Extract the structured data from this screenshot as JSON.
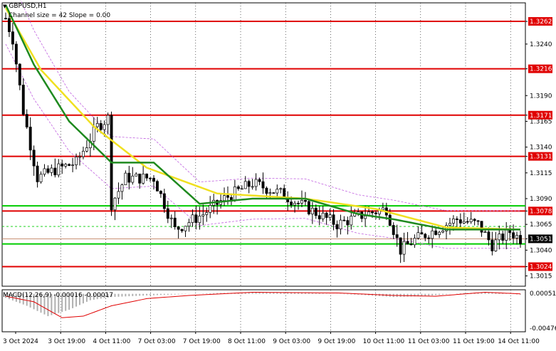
{
  "header": {
    "symbol_timeframe": "GBPUSD,H1",
    "channel_info": "Channel size = 42 Slope = 0.00"
  },
  "macd": {
    "label": "MACD(12,26,9) -0.00016 -0.00017",
    "axis_top": "0.00051",
    "axis_bottom": "-0.00476"
  },
  "colors": {
    "level_line": "#e00000",
    "support_line": "#00cc00",
    "candle": "#000000",
    "fast_ma": "#f0e020",
    "slow_ma": "#1f8a1f",
    "envelope": "#c060e0",
    "macd_hist": "#b0b0b0",
    "macd_signal": "#e00000",
    "price_label_bg": "#e00000",
    "current_price_bg": "#000000"
  },
  "chart_data": {
    "type": "candlestick",
    "symbol": "GBPUSD",
    "timeframe": "H1",
    "ylim": [
      1.3005,
      1.328
    ],
    "y_ticks": [
      "1.3262",
      "1.3240",
      "1.3216",
      "1.3190",
      "1.3171",
      "1.3165",
      "1.3140",
      "1.3131",
      "1.3115",
      "1.3090",
      "1.3078",
      "1.3065",
      "1.3051",
      "1.3040",
      "1.3024",
      "1.3015"
    ],
    "x_labels": [
      "3 Oct 2024",
      "3 Oct 19:00",
      "4 Oct 11:00",
      "7 Oct 03:00",
      "7 Oct 19:00",
      "8 Oct 11:00",
      "9 Oct 03:00",
      "9 Oct 19:00",
      "10 Oct 11:00",
      "11 Oct 03:00",
      "11 Oct 19:00",
      "14 Oct 11:00"
    ],
    "resistance_levels": [
      1.3262,
      1.3216,
      1.3171,
      1.3131,
      1.3078
    ],
    "support_levels": [
      1.3024
    ],
    "green_levels": [
      1.3083,
      1.3046
    ],
    "current_price": 1.3051,
    "key_points": [
      {
        "t": 0,
        "p": 1.3265
      },
      {
        "t": 2,
        "p": 1.3245
      },
      {
        "t": 5,
        "p": 1.3175
      },
      {
        "t": 9,
        "p": 1.311
      },
      {
        "t": 14,
        "p": 1.3118
      },
      {
        "t": 20,
        "p": 1.3125
      },
      {
        "t": 26,
        "p": 1.316
      },
      {
        "t": 29,
        "p": 1.3168
      },
      {
        "t": 30,
        "p": 1.3085
      },
      {
        "t": 34,
        "p": 1.311
      },
      {
        "t": 42,
        "p": 1.311
      },
      {
        "t": 48,
        "p": 1.306
      },
      {
        "t": 56,
        "p": 1.3075
      },
      {
        "t": 62,
        "p": 1.309
      },
      {
        "t": 70,
        "p": 1.3105
      },
      {
        "t": 78,
        "p": 1.3095
      },
      {
        "t": 86,
        "p": 1.308
      },
      {
        "t": 94,
        "p": 1.3065
      },
      {
        "t": 102,
        "p": 1.3075
      },
      {
        "t": 108,
        "p": 1.308
      },
      {
        "t": 112,
        "p": 1.304
      },
      {
        "t": 116,
        "p": 1.305
      },
      {
        "t": 122,
        "p": 1.306
      },
      {
        "t": 128,
        "p": 1.307
      },
      {
        "t": 134,
        "p": 1.3065
      },
      {
        "t": 138,
        "p": 1.3045
      },
      {
        "t": 143,
        "p": 1.3058
      },
      {
        "t": 146,
        "p": 1.3051
      }
    ],
    "fast_ma": [
      {
        "t": 0,
        "p": 1.3275
      },
      {
        "t": 10,
        "p": 1.3215
      },
      {
        "t": 25,
        "p": 1.316
      },
      {
        "t": 40,
        "p": 1.312
      },
      {
        "t": 60,
        "p": 1.3095
      },
      {
        "t": 85,
        "p": 1.309
      },
      {
        "t": 105,
        "p": 1.308
      },
      {
        "t": 125,
        "p": 1.3062
      },
      {
        "t": 146,
        "p": 1.306
      }
    ],
    "slow_ma": [
      {
        "t": 0,
        "p": 1.3278
      },
      {
        "t": 8,
        "p": 1.322
      },
      {
        "t": 18,
        "p": 1.3165
      },
      {
        "t": 30,
        "p": 1.3125
      },
      {
        "t": 42,
        "p": 1.3125
      },
      {
        "t": 55,
        "p": 1.3085
      },
      {
        "t": 70,
        "p": 1.309
      },
      {
        "t": 85,
        "p": 1.309
      },
      {
        "t": 100,
        "p": 1.3075
      },
      {
        "t": 110,
        "p": 1.307
      },
      {
        "t": 125,
        "p": 1.306
      },
      {
        "t": 135,
        "p": 1.306
      },
      {
        "t": 146,
        "p": 1.306
      }
    ],
    "macd_hist": [
      {
        "t": 0,
        "v": -0.0005
      },
      {
        "t": 6,
        "v": -0.0015
      },
      {
        "t": 12,
        "v": -0.0028
      },
      {
        "t": 18,
        "v": -0.002
      },
      {
        "t": 24,
        "v": -0.0008
      },
      {
        "t": 30,
        "v": -0.0004
      },
      {
        "t": 40,
        "v": -0.0002
      },
      {
        "t": 60,
        "v": 0.0001
      },
      {
        "t": 80,
        "v": 0.0002
      },
      {
        "t": 100,
        "v": -0.0001
      },
      {
        "t": 110,
        "v": -0.0004
      },
      {
        "t": 118,
        "v": -0.0003
      },
      {
        "t": 130,
        "v": 0.0001
      },
      {
        "t": 138,
        "v": 0.0002
      },
      {
        "t": 146,
        "v": -0.0001
      }
    ],
    "macd_signal": [
      {
        "t": 0,
        "v": -0.0003
      },
      {
        "t": 8,
        "v": -0.001
      },
      {
        "t": 16,
        "v": -0.003
      },
      {
        "t": 22,
        "v": -0.0028
      },
      {
        "t": 30,
        "v": -0.0015
      },
      {
        "t": 40,
        "v": -0.0006
      },
      {
        "t": 52,
        "v": -0.0002
      },
      {
        "t": 70,
        "v": 0.0002
      },
      {
        "t": 95,
        "v": 0.0001
      },
      {
        "t": 110,
        "v": -0.0002
      },
      {
        "t": 122,
        "v": -0.0003
      },
      {
        "t": 136,
        "v": 0.0002
      },
      {
        "t": 146,
        "v": 0.0
      }
    ],
    "macd_ylim": [
      -0.00476,
      0.00051
    ]
  }
}
